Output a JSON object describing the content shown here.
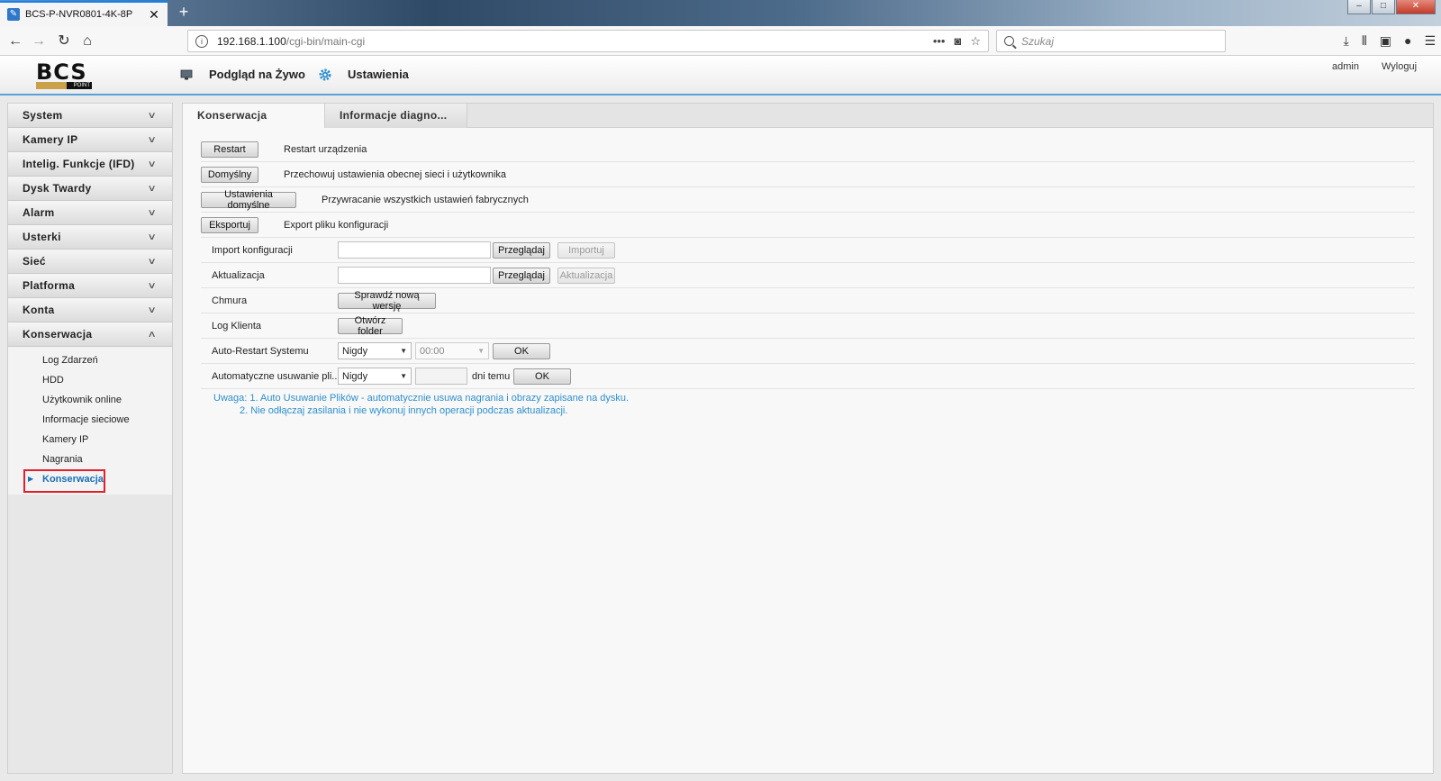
{
  "browser": {
    "tab_title": "BCS-P-NVR0801-4K-8P",
    "new_tab": "+",
    "url_host": "192.168.1.100",
    "url_path": "/cgi-bin/main-cgi",
    "search_placeholder": "Szukaj"
  },
  "header": {
    "logo_text": "BCS",
    "logo_sub": "POINT",
    "live_view_label": "Podgląd na Żywo",
    "settings_label": "Ustawienia",
    "user": "admin",
    "logout": "Wyloguj"
  },
  "sidebar": {
    "groups": [
      {
        "label": "System"
      },
      {
        "label": "Kamery IP"
      },
      {
        "label": "Intelig. Funkcje (IFD)"
      },
      {
        "label": "Dysk Twardy"
      },
      {
        "label": "Alarm"
      },
      {
        "label": "Usterki"
      },
      {
        "label": "Sieć"
      },
      {
        "label": "Platforma"
      },
      {
        "label": "Konta"
      },
      {
        "label": "Konserwacja"
      }
    ],
    "sub_items": [
      {
        "label": "Log Zdarzeń"
      },
      {
        "label": "HDD"
      },
      {
        "label": "Użytkownik online"
      },
      {
        "label": "Informacje sieciowe"
      },
      {
        "label": "Kamery IP"
      },
      {
        "label": "Nagrania"
      },
      {
        "label": "Konserwacja"
      }
    ]
  },
  "tabs": {
    "maintenance": "Konserwacja",
    "diagnostics": "Informacje diagno..."
  },
  "rows": {
    "restart": {
      "button": "Restart",
      "desc": "Restart urządzenia"
    },
    "default": {
      "button": "Domyślny",
      "desc": "Przechowuj ustawienia obecnej sieci i użytkownika"
    },
    "factory": {
      "button": "Ustawienia domyślne",
      "desc": "Przywracanie wszystkich ustawień fabrycznych"
    },
    "export": {
      "button": "Eksportuj",
      "desc": "Export pliku konfiguracji"
    },
    "import": {
      "label": "Import konfiguracji",
      "browse": "Przeglądaj",
      "action": "Importuj"
    },
    "update": {
      "label": "Aktualizacja",
      "browse": "Przeglądaj",
      "action": "Aktualizacja"
    },
    "cloud": {
      "label": "Chmura",
      "button": "Sprawdź nową wersję"
    },
    "client_log": {
      "label": "Log Klienta",
      "button": "Otwórz folder"
    },
    "auto_restart": {
      "label": "Auto-Restart Systemu",
      "select": "Nigdy",
      "time": "00:00",
      "ok": "OK"
    },
    "auto_delete": {
      "label": "Automatyczne usuwanie pli...",
      "select": "Nigdy",
      "days_value": "",
      "days_suffix": "dni temu",
      "ok": "OK"
    }
  },
  "notes": {
    "line1": "Uwaga: 1. Auto Usuwanie Plików - automatycznie usuwa nagrania i obrazy zapisane na dysku.",
    "line2": "2. Nie odłączaj zasilania i nie wykonuj innych operacji podczas aktualizacji."
  },
  "colors": {
    "accent_blue": "#2e8fcf",
    "highlight_red": "#e0202b"
  }
}
